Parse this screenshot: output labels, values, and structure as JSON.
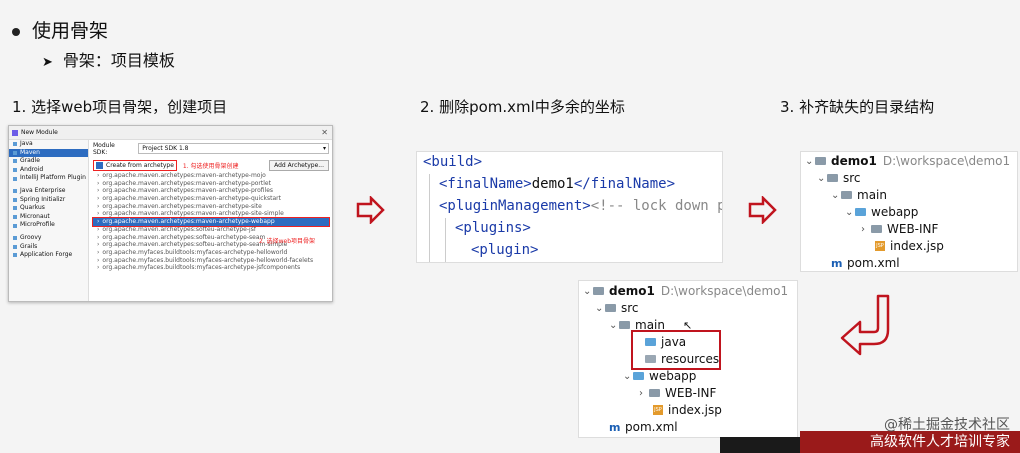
{
  "heading": "使用骨架",
  "subheading": "骨架：项目模板",
  "steps": [
    "1. 选择web项目骨架，创建项目",
    "2. 删除pom.xml中多余的坐标",
    "3. 补齐缺失的目录结构"
  ],
  "dialog": {
    "title": "New Module",
    "left_items": [
      "Java",
      "Maven",
      "Gradle",
      "Android",
      "IntelliJ Platform Plugin",
      "",
      "Java Enterprise",
      "Spring Initializr",
      "Quarkus",
      "Micronaut",
      "MicroProfile",
      "",
      "Groovy",
      "Grails",
      "Application Forge"
    ],
    "selected_left": 1,
    "module_sdk_label": "Module SDK:",
    "module_sdk_value": "Project SDK 1.8",
    "create_from_archetype": "Create from archetype",
    "note1": "1. 勾选使用骨架创建",
    "add_archetype": "Add Archetype...",
    "archetypes": [
      "org.apache.maven.archetypes:maven-archetype-mojo",
      "org.apache.maven.archetypes:maven-archetype-portlet",
      "org.apache.maven.archetypes:maven-archetype-profiles",
      "org.apache.maven.archetypes:maven-archetype-quickstart",
      "org.apache.maven.archetypes:maven-archetype-site",
      "org.apache.maven.archetypes:maven-archetype-site-simple",
      "org.apache.maven.archetypes:maven-archetype-webapp",
      "org.apache.maven.archetypes:softeu-archetype-jsf",
      "org.apache.maven.archetypes:softeu-archetype-seam",
      "org.apache.maven.archetypes:softeu-archetype-seam-simple",
      "org.apache.myfaces.buildtools:myfaces-archetype-helloworld",
      "org.apache.myfaces.buildtools:myfaces-archetype-helloworld-facelets",
      "org.apache.myfaces.buildtools:myfaces-archetype-jsfcomponents"
    ],
    "selected_archetype": 6,
    "note2": "2. 选择web项目骨架"
  },
  "code": {
    "line1": "<build>",
    "line2_open": "<finalName>",
    "line2_text": "demo1",
    "line2_close": "</finalName>",
    "line3_tag": "<pluginManagement>",
    "line3_comment": "<!-- lock down pl",
    "line4": "<plugins>",
    "line5": "<plugin>"
  },
  "tree_a": {
    "project": "demo1",
    "project_path": "D:\\workspace\\demo1",
    "src": "src",
    "main": "main",
    "webapp": "webapp",
    "webinf": "WEB-INF",
    "index": "index.jsp",
    "pom": "pom.xml"
  },
  "tree_b": {
    "project": "demo1",
    "project_path": "D:\\workspace\\demo1",
    "src": "src",
    "main": "main",
    "java": "java",
    "resources": "resources",
    "webapp": "webapp",
    "webinf": "WEB-INF",
    "index": "index.jsp",
    "pom": "pom.xml"
  },
  "watermark": "@稀土掘金技术社区",
  "banner": "高级软件人才培训专家",
  "colors": {
    "accent_red": "#c0141e",
    "selection_blue": "#2d6cc0",
    "tag_blue": "#1a3aa8"
  }
}
